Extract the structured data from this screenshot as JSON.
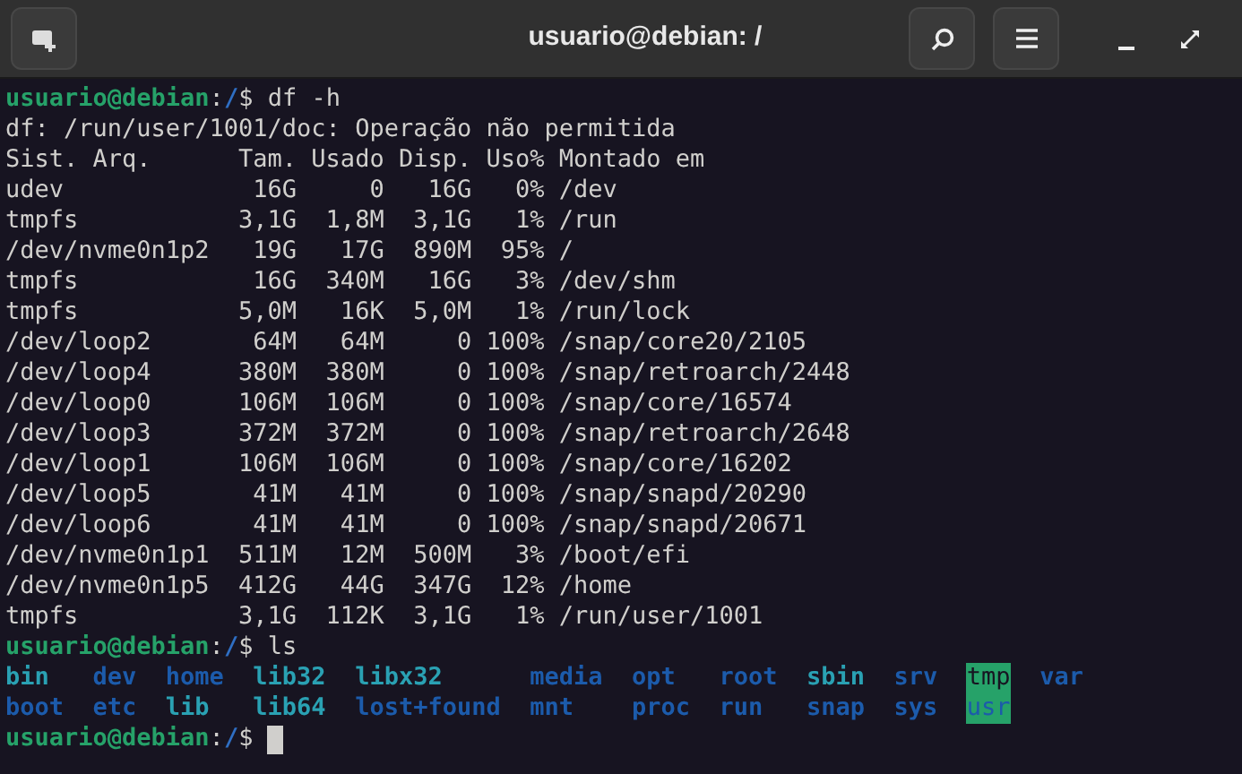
{
  "window": {
    "title": "usuario@debian: /"
  },
  "terminal": {
    "lines": [
      {
        "kind": "prompt",
        "user": "usuario@debian",
        "sep": ":",
        "path": "/",
        "sign": "$",
        "command": " df -h"
      },
      {
        "kind": "output",
        "text": "df: /run/user/1001/doc: Operação não permitida"
      },
      {
        "kind": "output",
        "text": "Sist. Arq.      Tam. Usado Disp. Uso% Montado em"
      },
      {
        "kind": "output",
        "text": "udev             16G     0   16G   0% /dev"
      },
      {
        "kind": "output",
        "text": "tmpfs           3,1G  1,8M  3,1G   1% /run"
      },
      {
        "kind": "output",
        "text": "/dev/nvme0n1p2   19G   17G  890M  95% /"
      },
      {
        "kind": "output",
        "text": "tmpfs            16G  340M   16G   3% /dev/shm"
      },
      {
        "kind": "output",
        "text": "tmpfs           5,0M   16K  5,0M   1% /run/lock"
      },
      {
        "kind": "output",
        "text": "/dev/loop2       64M   64M     0 100% /snap/core20/2105"
      },
      {
        "kind": "output",
        "text": "/dev/loop4      380M  380M     0 100% /snap/retroarch/2448"
      },
      {
        "kind": "output",
        "text": "/dev/loop0      106M  106M     0 100% /snap/core/16574"
      },
      {
        "kind": "output",
        "text": "/dev/loop3      372M  372M     0 100% /snap/retroarch/2648"
      },
      {
        "kind": "output",
        "text": "/dev/loop1      106M  106M     0 100% /snap/core/16202"
      },
      {
        "kind": "output",
        "text": "/dev/loop5       41M   41M     0 100% /snap/snapd/20290"
      },
      {
        "kind": "output",
        "text": "/dev/loop6       41M   41M     0 100% /snap/snapd/20671"
      },
      {
        "kind": "output",
        "text": "/dev/nvme0n1p1  511M   12M  500M   3% /boot/efi"
      },
      {
        "kind": "output",
        "text": "/dev/nvme0n1p5  412G   44G  347G  12% /home"
      },
      {
        "kind": "output",
        "text": "tmpfs           3,1G  112K  3,1G   1% /run/user/1001"
      },
      {
        "kind": "prompt",
        "user": "usuario@debian",
        "sep": ":",
        "path": "/",
        "sign": "$",
        "command": " ls"
      },
      {
        "kind": "listing",
        "columns": [
          [
            {
              "name": "bin",
              "kind": "link"
            },
            {
              "name": "boot",
              "kind": "dir"
            }
          ],
          [
            {
              "name": "dev",
              "kind": "dir"
            },
            {
              "name": "etc",
              "kind": "dir"
            }
          ],
          [
            {
              "name": "home",
              "kind": "dir"
            },
            {
              "name": "lib",
              "kind": "link"
            }
          ],
          [
            {
              "name": "lib32",
              "kind": "link"
            },
            {
              "name": "lib64",
              "kind": "link"
            }
          ],
          [
            {
              "name": "libx32",
              "kind": "link"
            },
            {
              "name": "lost+found",
              "kind": "dir"
            }
          ],
          [
            {
              "name": "media",
              "kind": "dir"
            },
            {
              "name": "mnt",
              "kind": "dir"
            }
          ],
          [
            {
              "name": "opt",
              "kind": "dir"
            },
            {
              "name": "proc",
              "kind": "dir"
            }
          ],
          [
            {
              "name": "root",
              "kind": "dir"
            },
            {
              "name": "run",
              "kind": "dir"
            }
          ],
          [
            {
              "name": "sbin",
              "kind": "link"
            },
            {
              "name": "snap",
              "kind": "dir"
            }
          ],
          [
            {
              "name": "srv",
              "kind": "dir"
            },
            {
              "name": "sys",
              "kind": "dir"
            }
          ],
          [
            {
              "name": "tmp",
              "kind": "sticky"
            },
            {
              "name": "usr",
              "kind": "marked"
            }
          ],
          [
            {
              "name": "var",
              "kind": "dir"
            }
          ]
        ]
      },
      {
        "kind": "prompt",
        "user": "usuario@debian",
        "sep": ":",
        "path": "/",
        "sign": "$",
        "cursor": true
      }
    ]
  }
}
